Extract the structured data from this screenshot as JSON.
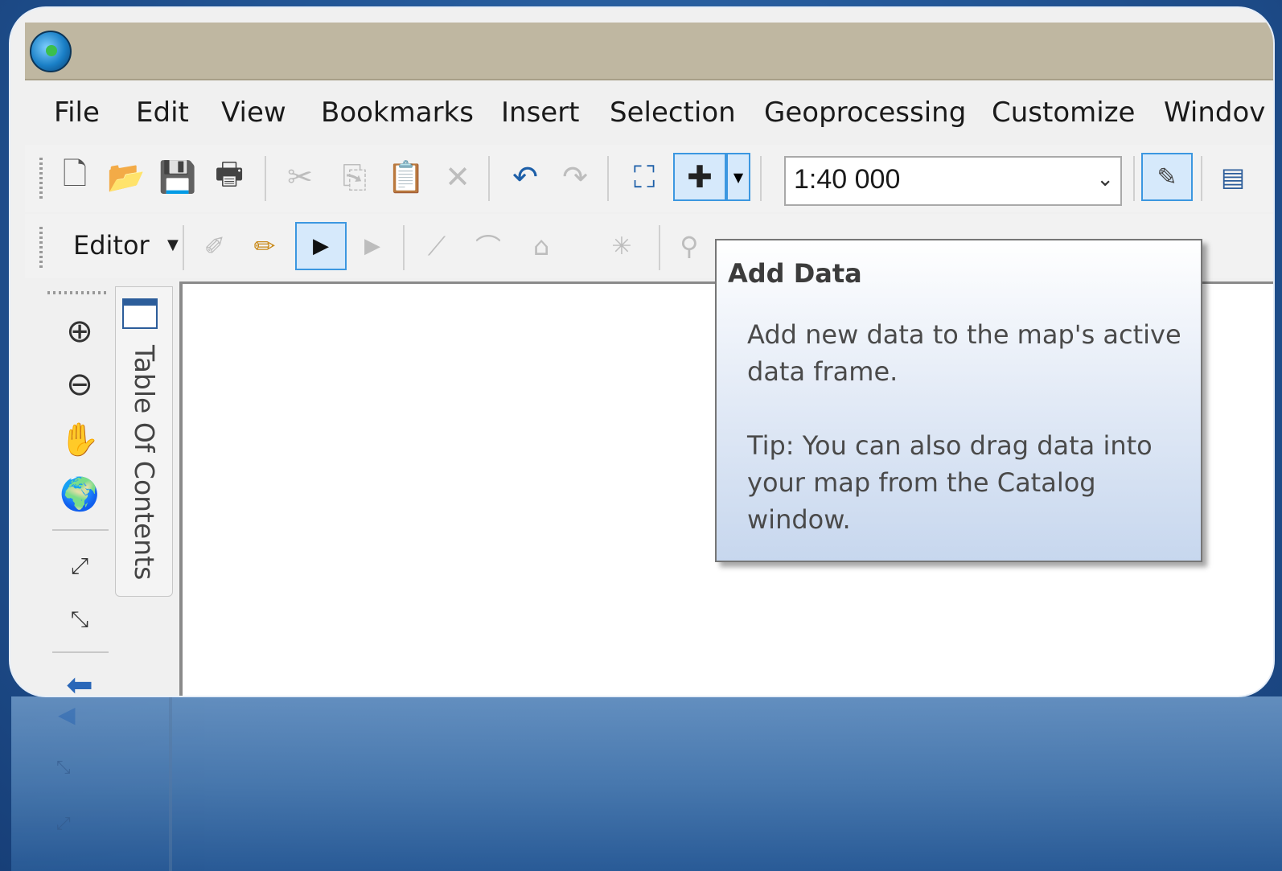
{
  "menu": {
    "items": [
      "File",
      "Edit",
      "View",
      "Bookmarks",
      "Insert",
      "Selection",
      "Geoprocessing",
      "Customize",
      "Windov"
    ]
  },
  "standard_toolbar": {
    "scale_value": "1:40 000"
  },
  "editor_toolbar": {
    "editor_label": "Editor"
  },
  "toc": {
    "tab_label": "Table Of Contents"
  },
  "tooltip": {
    "title": "Add Data",
    "description": "Add new data to the map's active data frame.",
    "tip": "Tip: You can also drag data into your map from the Catalog window."
  },
  "colors": {
    "titlebar": "#bfb7a1",
    "accent": "#3c97e0",
    "background": "#24599a"
  }
}
